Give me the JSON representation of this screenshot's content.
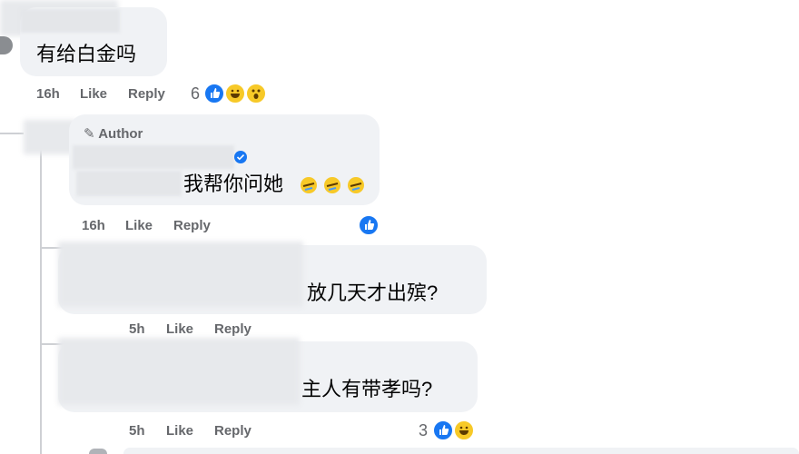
{
  "comment1": {
    "text": "有给白金吗",
    "time": "16h",
    "like": "Like",
    "reply": "Reply",
    "reaction_count": "6",
    "reactions": [
      "like-icon",
      "haha-icon",
      "wow-icon"
    ]
  },
  "comment2": {
    "badge": "Author",
    "text": "我帮你问她",
    "time": "16h",
    "like": "Like",
    "reply": "Reply",
    "reactions": [
      "like-icon"
    ]
  },
  "comment3": {
    "text": "放几天才出殡?",
    "time": "5h",
    "like": "Like",
    "reply": "Reply"
  },
  "comment4": {
    "text": "主人有带孝吗?",
    "time": "5h",
    "like": "Like",
    "reply": "Reply",
    "reaction_count": "3",
    "reactions": [
      "like-icon",
      "haha-icon"
    ]
  },
  "colors": {
    "like_blue": "#1877f2",
    "emoji_yellow": "#f7c928",
    "meta_gray": "#65676b",
    "bubble_bg": "#f0f2f5"
  }
}
